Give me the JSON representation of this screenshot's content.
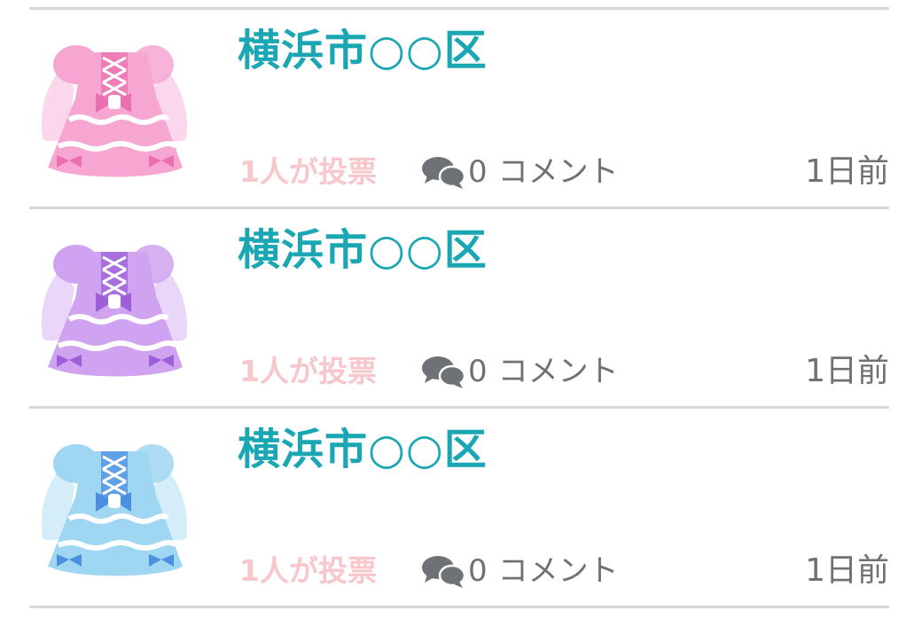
{
  "colors": {
    "title": "#1ba6b4",
    "votes": "#f7c7cc",
    "meta": "#6e7176",
    "divider": "#d5d8dc"
  },
  "posts": [
    {
      "title": "横浜市○○区",
      "votes": "1人が投票",
      "comment_count": "0",
      "comment_label": "コメント",
      "age": "1日前",
      "thumb_color": "#f7a6d2",
      "thumb_color_dark": "#ea6fae",
      "thumb_icon": "pink-dress-icon"
    },
    {
      "title": "横浜市○○区",
      "votes": "1人が投票",
      "comment_count": "0",
      "comment_label": "コメント",
      "age": "1日前",
      "thumb_color": "#cfa3ef",
      "thumb_color_dark": "#9d5ed8",
      "thumb_icon": "purple-dress-icon"
    },
    {
      "title": "横浜市○○区",
      "votes": "1人が投票",
      "comment_count": "0",
      "comment_label": "コメント",
      "age": "1日前",
      "thumb_color": "#9fd6f2",
      "thumb_color_dark": "#4b8fe0",
      "thumb_icon": "blue-dress-icon"
    }
  ]
}
